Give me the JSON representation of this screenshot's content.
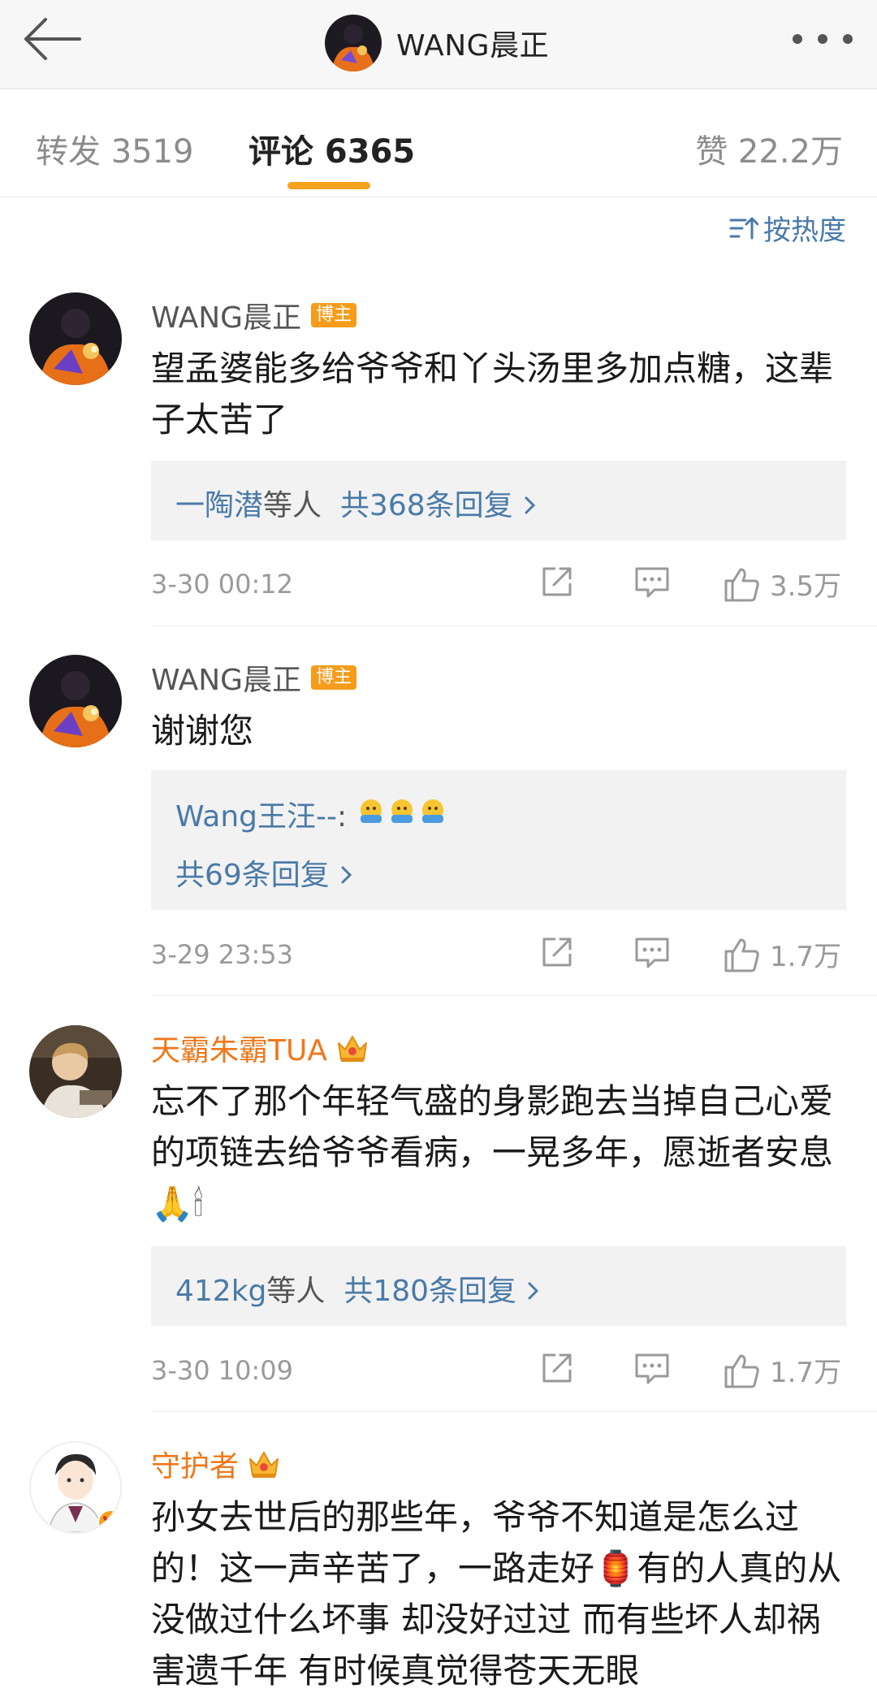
{
  "header": {
    "title": "WANG晨正"
  },
  "tabs": {
    "repost": "转发 3519",
    "comment": "评论 6365",
    "like": "赞 22.2万"
  },
  "sort": {
    "label": "按热度"
  },
  "comments": [
    {
      "user": "WANG晨正",
      "badge": "博主",
      "text": "望孟婆能多给爷爷和丫头汤里多加点糖，这辈子太苦了",
      "reply_users": "一陶潜",
      "reply_suffix": "等人",
      "reply_count": "共368条回复",
      "time": "3-30 00:12",
      "likes": "3.5万"
    },
    {
      "user": "WANG晨正",
      "badge": "博主",
      "text": "谢谢您",
      "reply_preview_user": "Wang王汪--",
      "reply_preview_sep": ":",
      "reply_count": "共69条回复",
      "time": "3-29 23:53",
      "likes": "1.7万"
    },
    {
      "user": "天霸朱霸TUA",
      "text": "忘不了那个年轻气盛的身影跑去当掉自己心爱的项链去给爷爷看病，一晃多年，愿逝者安息🙏🕯",
      "reply_users": "412kg",
      "reply_suffix": "等人",
      "reply_count": "共180条回复",
      "time": "3-30 10:09",
      "likes": "1.7万"
    },
    {
      "user": "守护者",
      "text": "孙女去世后的那些年，爷爷不知道是怎么过的！这一声辛苦了，一路走好🏮有的人真的从没做过什么坏事 却没好过过 而有些坏人却祸害遗千年 有时候真觉得苍天无眼"
    }
  ],
  "colors": {
    "accent": "#f7a11c",
    "link": "#4a7aa8",
    "vip_name": "#f0771a",
    "badge": "#f59d1b"
  }
}
